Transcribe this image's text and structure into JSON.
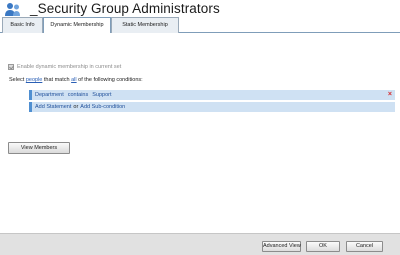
{
  "header": {
    "title": "_Security Group Administrators",
    "icon": "users-icon"
  },
  "tabs": [
    {
      "label": "Basic Info",
      "active": false
    },
    {
      "label": "Dynamic Membership",
      "active": true
    },
    {
      "label": "Static Membership",
      "active": false
    }
  ],
  "dynamic": {
    "enable_label": "Enable dynamic membership in current set",
    "enabled": true,
    "select_prefix": "Select ",
    "select_people": "people",
    "select_middle": " that match ",
    "select_all": "all",
    "select_suffix": " of the following conditions:",
    "condition": {
      "field": "Department",
      "operator": "contains",
      "value": "Support",
      "remove_label": "×"
    },
    "add_statement": "Add Statement",
    "add_or": "or",
    "add_subcondition": "Add Sub-condition",
    "view_members": "View Members"
  },
  "footer": {
    "advanced_view": "Advanced View",
    "ok": "OK",
    "cancel": "Cancel"
  },
  "colors": {
    "condition_row": "#cfe1f3",
    "link": "#2a5fb5",
    "remove": "#d6282b"
  }
}
